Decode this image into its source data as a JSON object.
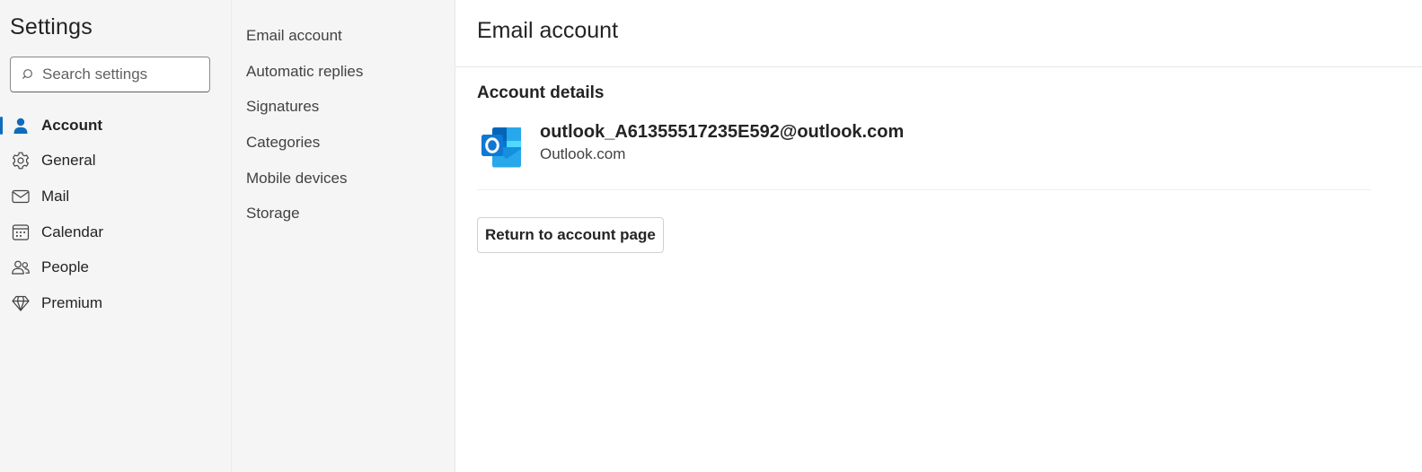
{
  "sidebar": {
    "title": "Settings",
    "search": {
      "placeholder": "Search settings",
      "value": ""
    },
    "items": [
      {
        "label": "Account",
        "icon": "person-icon",
        "active": true
      },
      {
        "label": "General",
        "icon": "gear-icon",
        "active": false
      },
      {
        "label": "Mail",
        "icon": "mail-icon",
        "active": false
      },
      {
        "label": "Calendar",
        "icon": "calendar-icon",
        "active": false
      },
      {
        "label": "People",
        "icon": "people-icon",
        "active": false
      },
      {
        "label": "Premium",
        "icon": "diamond-icon",
        "active": false
      }
    ]
  },
  "subnav": {
    "items": [
      {
        "label": "Email account"
      },
      {
        "label": "Automatic replies"
      },
      {
        "label": "Signatures"
      },
      {
        "label": "Categories"
      },
      {
        "label": "Mobile devices"
      },
      {
        "label": "Storage"
      }
    ]
  },
  "main": {
    "title": "Email account",
    "section_title": "Account details",
    "account": {
      "email": "outlook_A61355517235E592@outlook.com",
      "type": "Outlook.com",
      "logo": "outlook-logo-icon"
    },
    "return_button": "Return to account page"
  },
  "colors": {
    "accent": "#0f6cbd",
    "sidebar_bg": "#f5f5f5",
    "text_primary": "#242424"
  }
}
